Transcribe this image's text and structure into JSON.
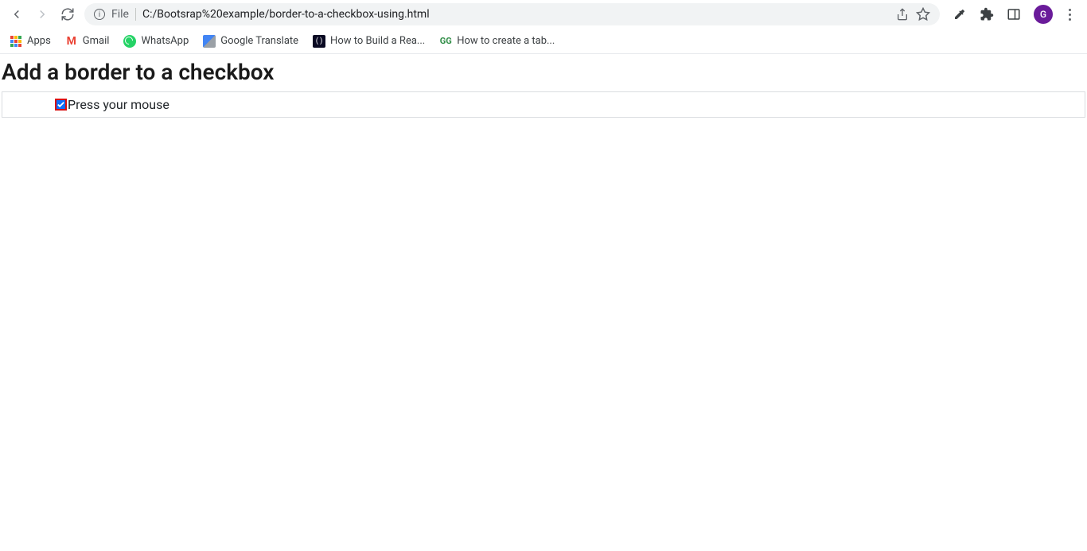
{
  "browser": {
    "address": {
      "file_label": "File",
      "url": "C:/Bootsrap%20example/border-to-a-checkbox-using.html"
    },
    "avatar_letter": "G"
  },
  "bookmarks": {
    "apps": "Apps",
    "gmail": "Gmail",
    "whatsapp": "WhatsApp",
    "translate": "Google Translate",
    "howto_build": "How to Build a Rea...",
    "howto_create": "How to create a tab..."
  },
  "page": {
    "heading": "Add a border to a checkbox",
    "checkbox_label": "Press your mouse"
  }
}
